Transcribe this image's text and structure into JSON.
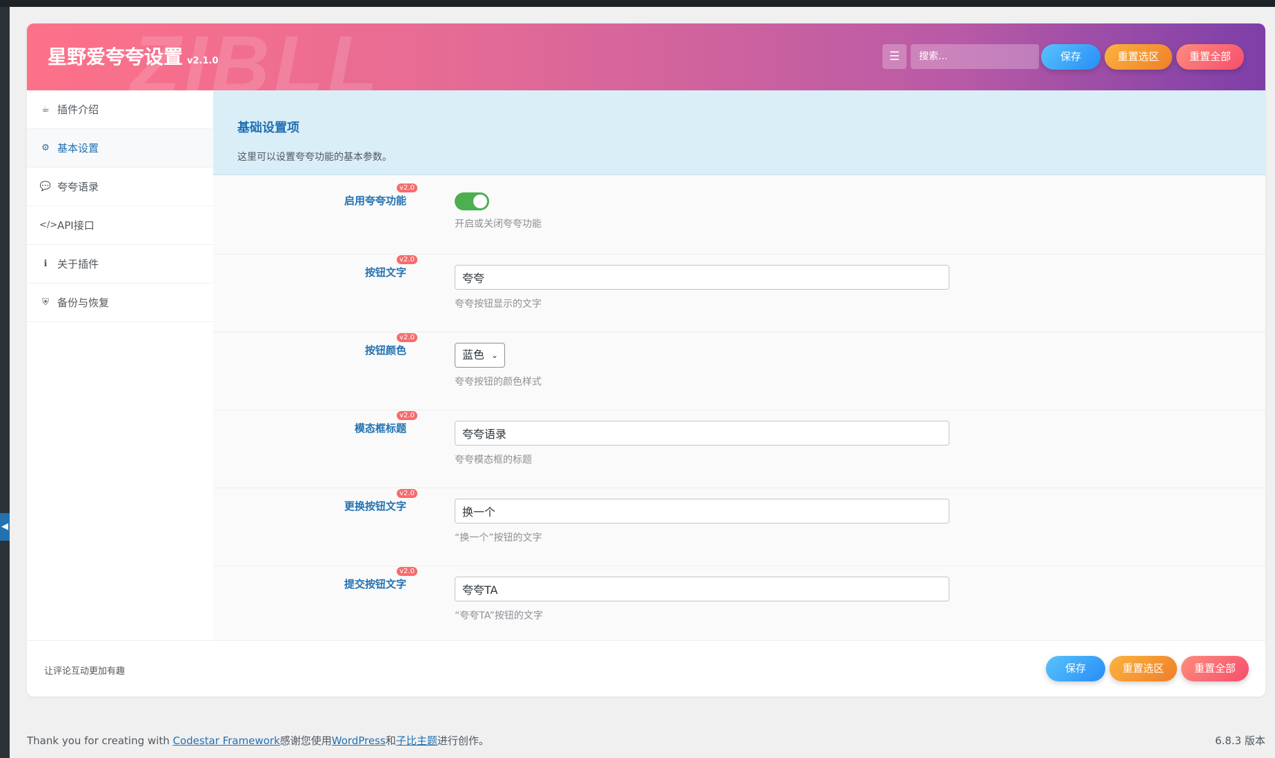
{
  "header": {
    "title": "星野爱夸夸设置",
    "version": "v2.1.0",
    "watermark": "ZIBLL",
    "search_placeholder": "搜索...",
    "save_label": "保存",
    "reset_section_label": "重置选区",
    "reset_all_label": "重置全部"
  },
  "sidebar": {
    "items": [
      {
        "icon": "coffee-icon",
        "label": "插件介绍"
      },
      {
        "icon": "gears-icon",
        "label": "基本设置"
      },
      {
        "icon": "comment-icon",
        "label": "夸夸语录"
      },
      {
        "icon": "code-icon",
        "label": "API接口"
      },
      {
        "icon": "info-icon",
        "label": "关于插件"
      },
      {
        "icon": "shield-icon",
        "label": "备份与恢复"
      }
    ],
    "active_index": 1
  },
  "section": {
    "title": "基础设置项",
    "description": "这里可以设置夸夸功能的基本参数。"
  },
  "fields": [
    {
      "label": "启用夸夸功能",
      "badge": "v2.0",
      "type": "toggle",
      "value": true,
      "help": "开启或关闭夸夸功能"
    },
    {
      "label": "按钮文字",
      "badge": "v2.0",
      "type": "text",
      "value": "夸夸",
      "help": "夸夸按钮显示的文字"
    },
    {
      "label": "按钮颜色",
      "badge": "v2.0",
      "type": "select",
      "value": "蓝色",
      "help": "夸夸按钮的颜色样式"
    },
    {
      "label": "模态框标题",
      "badge": "v2.0",
      "type": "text",
      "value": "夸夸语录",
      "help": "夸夸模态框的标题"
    },
    {
      "label": "更换按钮文字",
      "badge": "v2.0",
      "type": "text",
      "value": "换一个",
      "help": "“换一个”按钮的文字"
    },
    {
      "label": "提交按钮文字",
      "badge": "v2.0",
      "type": "text",
      "value": "夸夸TA",
      "help": "“夸夸TA”按钮的文字"
    }
  ],
  "footer": {
    "text": "让评论互动更加有趣",
    "save_label": "保存",
    "reset_section_label": "重置选区",
    "reset_all_label": "重置全部"
  },
  "credits": {
    "prefix": "Thank you for creating with ",
    "link1": "Codestar Framework",
    "mid1": "感谢您使用",
    "link2": "WordPress",
    "mid2": "和",
    "link3": "子比主题",
    "suffix": "进行创作。",
    "wp_version": "6.8.3 版本"
  },
  "colors": {
    "accent": "#2271b1",
    "toggle_on": "#4caf50",
    "badge": "#f56c6c"
  }
}
